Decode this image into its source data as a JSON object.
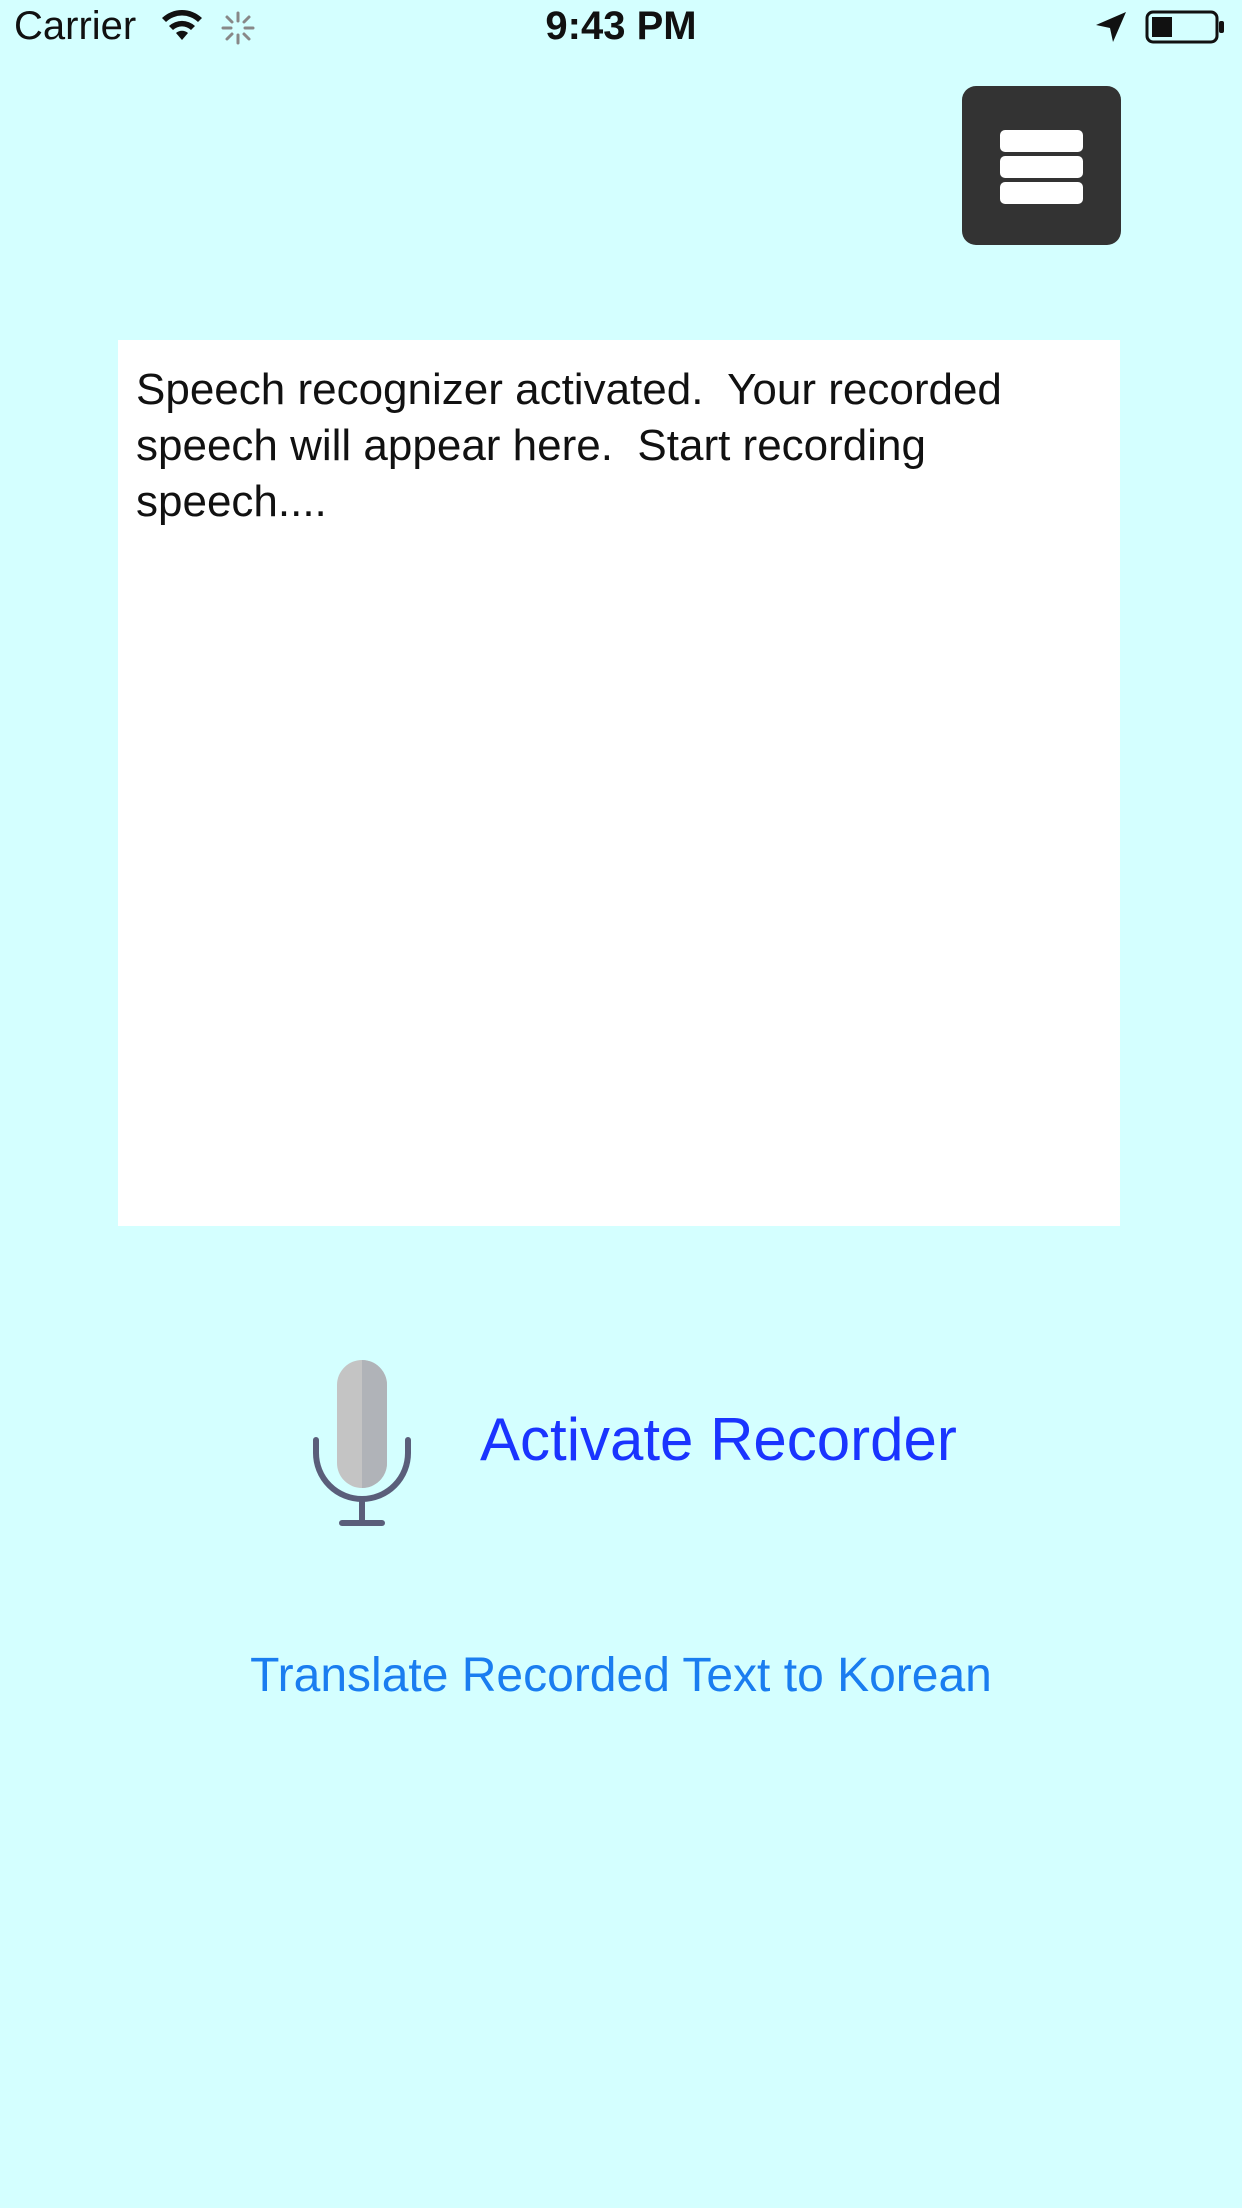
{
  "status_bar": {
    "carrier": "Carrier",
    "time": "9:43 PM",
    "icons": [
      "wifi-icon",
      "activity-spinner-icon",
      "location-arrow-icon",
      "battery-icon"
    ]
  },
  "menu": {
    "icon": "hamburger-menu-icon"
  },
  "transcript": {
    "text": "Speech recognizer activated.  Your recorded speech will appear here.  Start recording speech...."
  },
  "recorder": {
    "icon": "microphone-icon",
    "activate_label": "Activate Recorder"
  },
  "translate": {
    "label": "Translate Recorded Text to Korean"
  },
  "colors": {
    "background": "#d4ffff",
    "menu_button": "#333333",
    "activate_text": "#1a34ff",
    "translate_text": "#1a7df0"
  }
}
